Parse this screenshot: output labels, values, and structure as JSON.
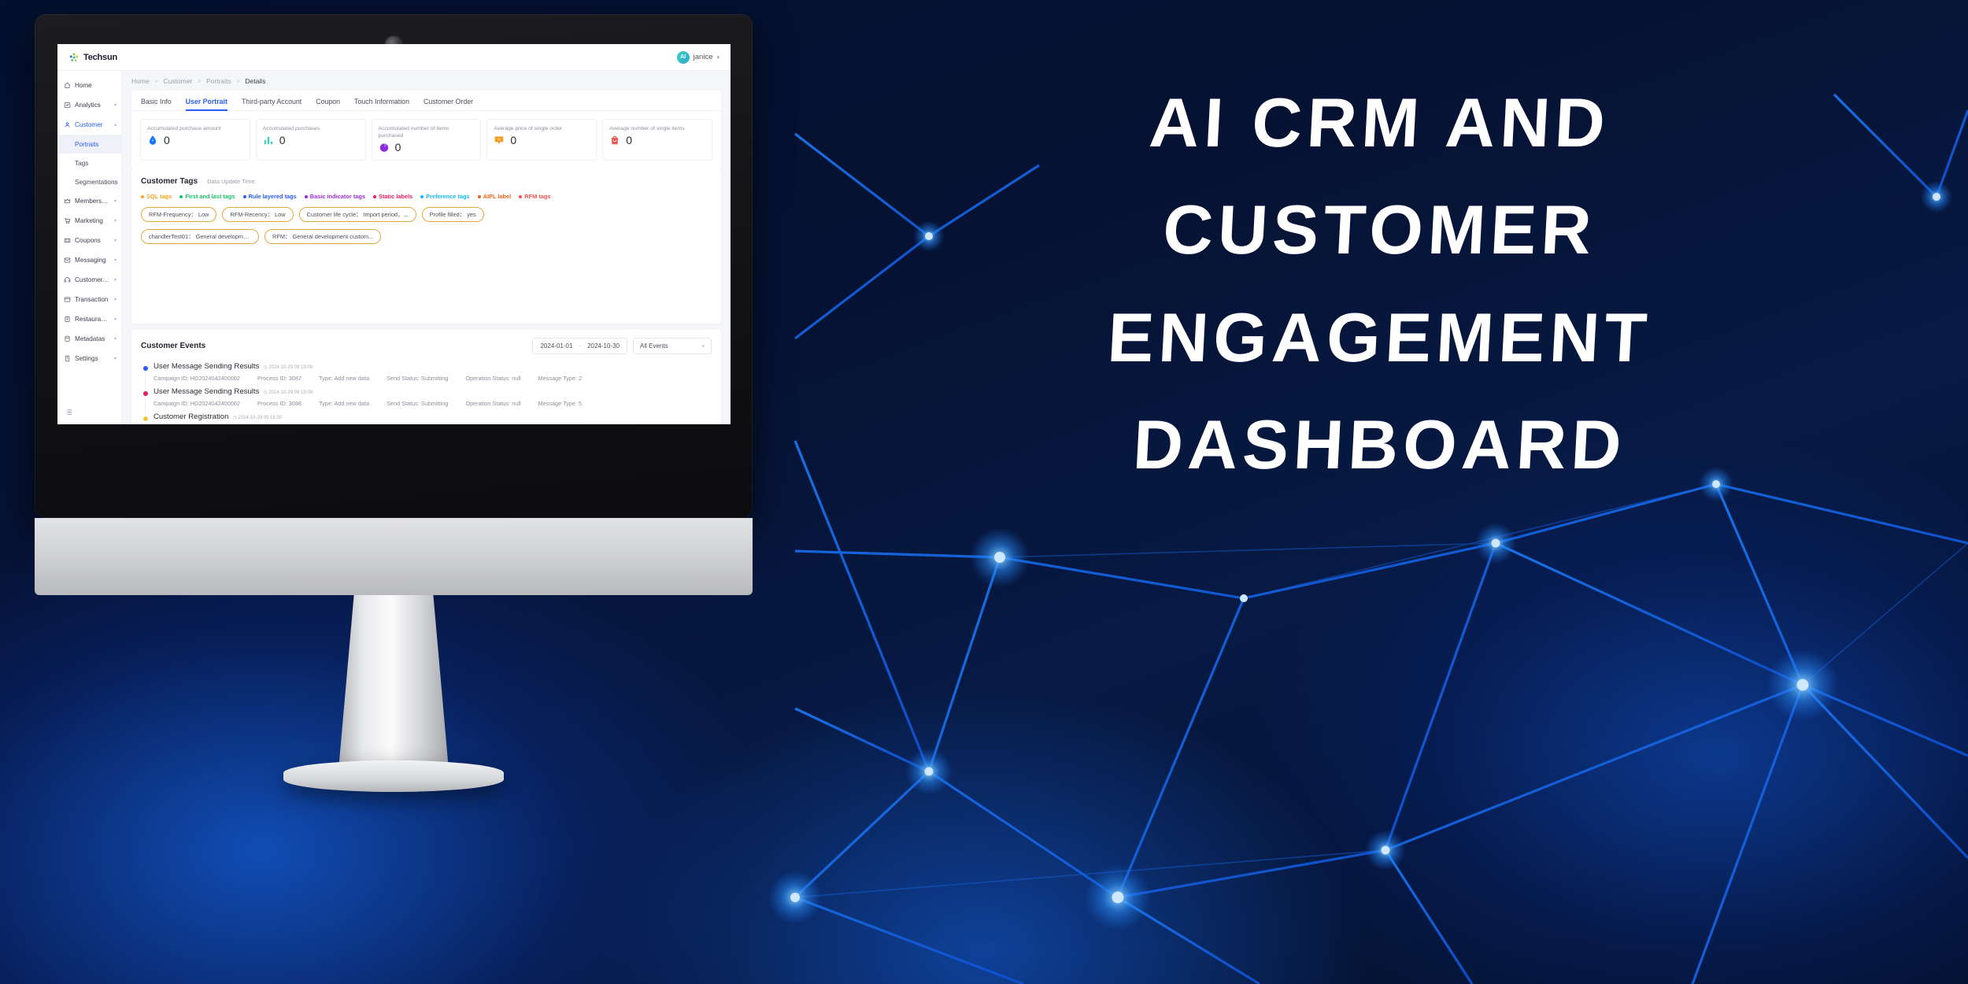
{
  "banner": {
    "lines": [
      "AI CRM AND",
      "CUSTOMER",
      "ENGAGEMENT",
      "DASHBOARD"
    ],
    "text_color": "#ffffff",
    "bg_color": "#040c2e"
  },
  "app": {
    "brand": "Techsun",
    "user": {
      "name": "janice",
      "avatar_initials": "AI",
      "caret": "▾"
    }
  },
  "sidebar": {
    "items": [
      {
        "label": "Home",
        "icon": "home-icon",
        "expandable": false,
        "active": false
      },
      {
        "label": "Analytics",
        "icon": "chart-icon",
        "expandable": true,
        "active": false
      },
      {
        "label": "Customer",
        "icon": "user-icon",
        "expandable": true,
        "active": true,
        "expanded": true
      },
      {
        "label": "Membership",
        "icon": "crown-icon",
        "expandable": true,
        "active": false
      },
      {
        "label": "Marketing",
        "icon": "cart-icon",
        "expandable": true,
        "active": false
      },
      {
        "label": "Coupons",
        "icon": "ticket-icon",
        "expandable": true,
        "active": false
      },
      {
        "label": "Messaging",
        "icon": "mail-icon",
        "expandable": true,
        "active": false
      },
      {
        "label": "Customer Ser...",
        "icon": "headset-icon",
        "expandable": true,
        "active": false
      },
      {
        "label": "Transaction",
        "icon": "card-icon",
        "expandable": true,
        "active": false
      },
      {
        "label": "Restaurant M...",
        "icon": "store-icon",
        "expandable": true,
        "active": false
      },
      {
        "label": "Metadatas",
        "icon": "database-icon",
        "expandable": true,
        "active": false
      },
      {
        "label": "Settings",
        "icon": "settings-icon",
        "expandable": true,
        "active": false
      }
    ],
    "sub_items": [
      {
        "label": "Portraits",
        "current": true
      },
      {
        "label": "Tags",
        "current": false
      },
      {
        "label": "Segmentations",
        "current": false
      }
    ],
    "collapse_icon": "list-collapse-icon"
  },
  "breadcrumb": {
    "items": [
      "Home",
      "Customer",
      "Portraits"
    ],
    "current": "Details",
    "separator": ">"
  },
  "tabs": [
    {
      "label": "Basic Info",
      "active": false
    },
    {
      "label": "User Portrait",
      "active": true
    },
    {
      "label": "Third-party Account",
      "active": false
    },
    {
      "label": "Coupon",
      "active": false
    },
    {
      "label": "Touch Information",
      "active": false
    },
    {
      "label": "Customer Order",
      "active": false
    }
  ],
  "stats": [
    {
      "title": "Accumulated purchase amount",
      "value": "0",
      "icon": "droplet-icon",
      "color": "#1677ff"
    },
    {
      "title": "Accumulated purchases",
      "value": "0",
      "icon": "bar-chart-icon",
      "color": "#3ecfc0"
    },
    {
      "title": "Accumulated number of items purchased",
      "value": "0",
      "icon": "pie-chart-icon",
      "color": "#8b2ce0"
    },
    {
      "title": "Average price of single order",
      "value": "0",
      "icon": "tag-badge-icon",
      "color": "#f59a23"
    },
    {
      "title": "Average number of single items",
      "value": "0",
      "icon": "bag-icon",
      "color": "#f0534f"
    }
  ],
  "customer_tags": {
    "title": "Customer Tags",
    "data_update_label": "Data Update Time:",
    "data_update_value": "",
    "legend": [
      {
        "label": "SQL tags",
        "color": "#f5a623"
      },
      {
        "label": "First and last tags",
        "color": "#1bbf6b"
      },
      {
        "label": "Rule layered tags",
        "color": "#2a5cf5"
      },
      {
        "label": "Basic indicator tags",
        "color": "#9b2fd6"
      },
      {
        "label": "Static labels",
        "color": "#e0205a"
      },
      {
        "label": "Preference tags",
        "color": "#17b8e8"
      },
      {
        "label": "AIPL label",
        "color": "#e8651a"
      },
      {
        "label": "RFM tags",
        "color": "#f0534f"
      }
    ],
    "chips": [
      "RFM-Frequency： Low",
      "RFM-Recency： Low",
      "Customer life cycle： Import period，...",
      "Profile filled： yes",
      "chandlerTest01： General developme...",
      "RFM： General development custom..."
    ]
  },
  "customer_events": {
    "title": "Customer Events",
    "date_from": "2024-01-01",
    "date_to": "2024-10-30",
    "date_separator": "-",
    "event_filter": "All Events",
    "filter_caret": "∨",
    "labels": {
      "campaign_id": "Campaign ID:",
      "process_id": "Process ID:",
      "type": "Type:",
      "send_status": "Send Status:",
      "operation_status": "Operation Status:",
      "message_type": "Message Type:"
    },
    "items": [
      {
        "name": "User Message Sending Results",
        "time": "2024-10-29 09:19:09",
        "dot_color": "#2a5cf5",
        "campaign_id": "HD2024042400002",
        "process_id": "3087",
        "type": "Add new data",
        "send_status": "Submitting",
        "operation_status": "null",
        "message_type": "2"
      },
      {
        "name": "User Message Sending Results",
        "time": "2024-10-29 09:19:09",
        "dot_color": "#e0205a",
        "campaign_id": "HD2024042400002",
        "process_id": "3088",
        "type": "Add new data",
        "send_status": "Submitting",
        "operation_status": "null",
        "message_type": "5"
      },
      {
        "name": "Customer Registration",
        "time": "2024-10-29 09:18:30",
        "dot_color": "#f5c33b",
        "campaign_id": "",
        "process_id": "",
        "type": "",
        "send_status": "",
        "operation_status": "",
        "message_type": ""
      }
    ]
  }
}
